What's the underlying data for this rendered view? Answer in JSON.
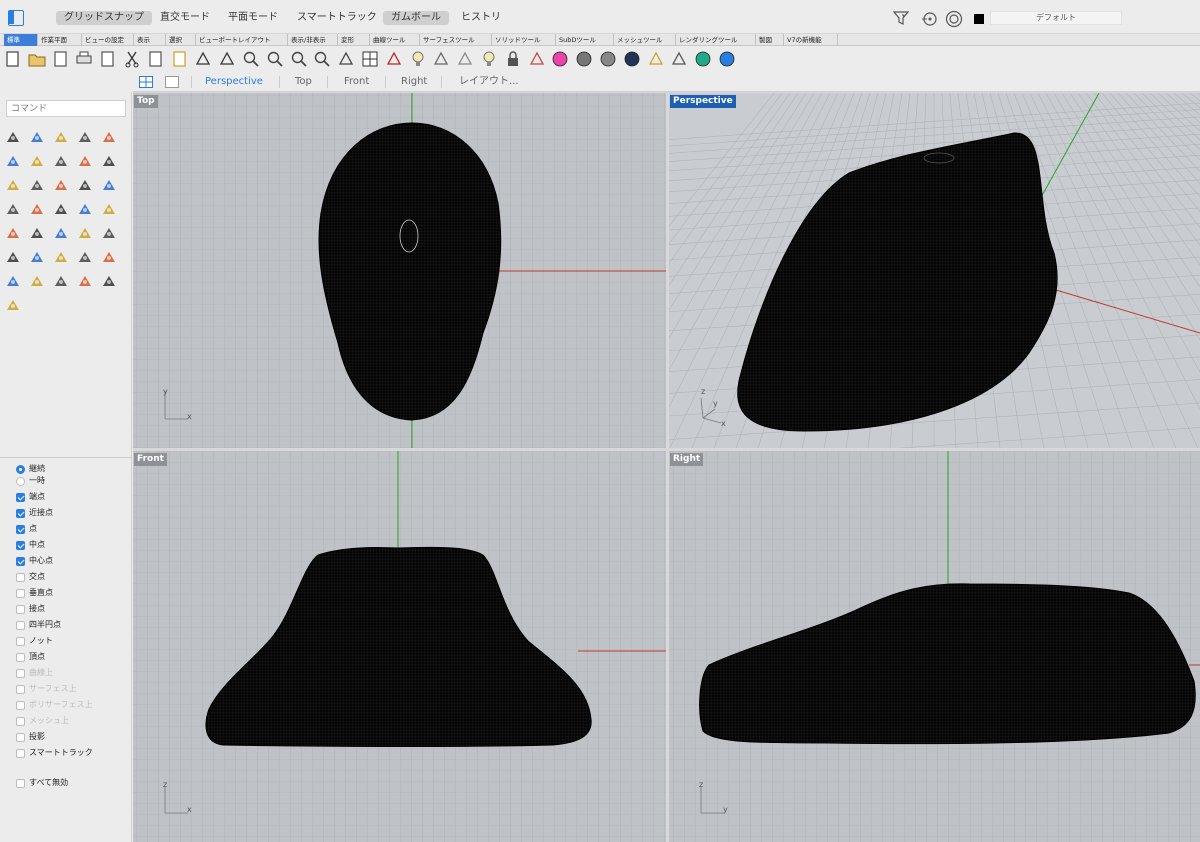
{
  "topbar": {
    "modes": [
      {
        "label": "グリッドスナップ",
        "on": true
      },
      {
        "label": "直交モード",
        "on": false
      },
      {
        "label": "平面モード",
        "on": false
      },
      {
        "label": "スマートトラック",
        "on": false
      },
      {
        "label": "ガムボール",
        "on": true
      },
      {
        "label": "ヒストリ",
        "on": false
      }
    ],
    "layer_name": "デフォルト"
  },
  "tabs": [
    {
      "label": "標準",
      "on": true
    },
    {
      "label": "作業平面"
    },
    {
      "label": "ビューの設定"
    },
    {
      "label": "表示"
    },
    {
      "label": "選択"
    },
    {
      "label": "ビューポートレイアウト"
    },
    {
      "label": "表示/非表示"
    },
    {
      "label": "変形"
    },
    {
      "label": "曲線ツール"
    },
    {
      "label": "サーフェスツール"
    },
    {
      "label": "ソリッドツール"
    },
    {
      "label": "SubDツール"
    },
    {
      "label": "メッシュツール"
    },
    {
      "label": "レンダリングツール"
    },
    {
      "label": "製図"
    },
    {
      "label": "V7の新機能"
    }
  ],
  "toolbar_icons": [
    "new-file-icon",
    "open-folder-icon",
    "save-icon",
    "print-icon",
    "import-icon",
    "cut-icon",
    "copy-icon",
    "paste-icon",
    "undo-icon",
    "pan-hand-icon",
    "zoom-icon",
    "zoom-window-icon",
    "zoom-extents-icon",
    "zoom-selected-icon",
    "rotate-view-icon",
    "four-viewports-icon",
    "car-icon",
    "lightbulb-icon",
    "select-icon",
    "cplane-icon",
    "light-icon",
    "lock-icon",
    "material-icon",
    "color-wheel-icon",
    "shaded-sphere-icon",
    "render-sphere-icon",
    "globe-icon",
    "properties-icon",
    "history-icon",
    "globe-green-icon",
    "help-icon"
  ],
  "viewtabs": {
    "items": [
      "Perspective",
      "Top",
      "Front",
      "Right",
      "レイアウト..."
    ],
    "active": 0
  },
  "command": {
    "placeholder": "コマンド"
  },
  "snaps": {
    "mode_items": [
      {
        "label": "継続",
        "on": true
      },
      {
        "label": "一時",
        "on": false
      }
    ],
    "items": [
      {
        "label": "端点",
        "on": true
      },
      {
        "label": "近接点",
        "on": true
      },
      {
        "label": "点",
        "on": true
      },
      {
        "label": "中点",
        "on": true
      },
      {
        "label": "中心点",
        "on": true
      },
      {
        "label": "交点",
        "on": false
      },
      {
        "label": "垂直点",
        "on": false
      },
      {
        "label": "接点",
        "on": false
      },
      {
        "label": "四半円点",
        "on": false
      },
      {
        "label": "ノット",
        "on": false
      },
      {
        "label": "頂点",
        "on": false
      },
      {
        "label": "曲線上",
        "on": false,
        "disabled": true
      },
      {
        "label": "サーフェス上",
        "on": false,
        "disabled": true
      },
      {
        "label": "ポリサーフェス上",
        "on": false,
        "disabled": true
      },
      {
        "label": "メッシュ上",
        "on": false,
        "disabled": true
      },
      {
        "label": "投影",
        "on": false
      },
      {
        "label": "スマートトラック",
        "on": false
      }
    ],
    "disable_all": "すべて無効"
  },
  "viewports": {
    "top": {
      "label": "Top",
      "axis": [
        "y",
        "x"
      ]
    },
    "perspective": {
      "label": "Perspective",
      "axis": [
        "z",
        "y",
        "x"
      ]
    },
    "front": {
      "label": "Front",
      "axis": [
        "z",
        "x"
      ]
    },
    "right": {
      "label": "Right",
      "axis": [
        "z",
        "y"
      ]
    }
  },
  "colors": {
    "active_tab": "#3d7fd8",
    "accent": "#2a7de1",
    "viewport_bg": "#bfc3c7",
    "active_viewport_label": "#1d5fb0",
    "x_axis": "#c0392b",
    "y_axis": "#27a327",
    "mesh": "#000000"
  }
}
